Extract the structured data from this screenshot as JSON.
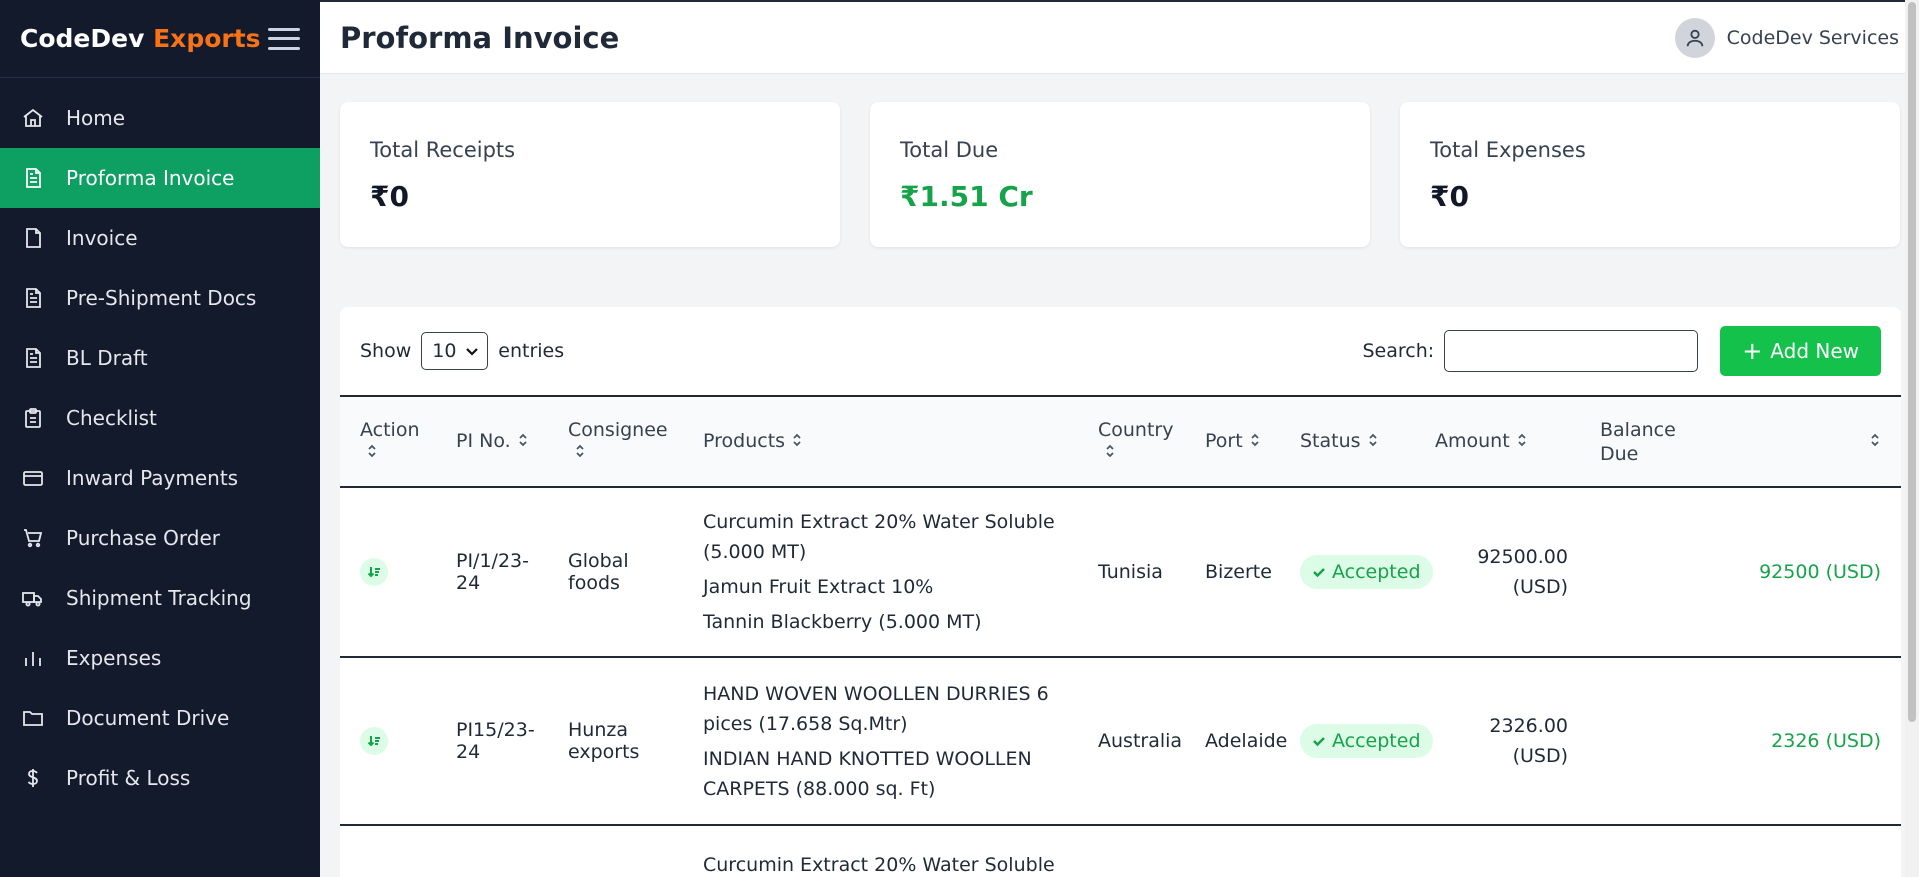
{
  "brand": {
    "name": "CodeDev",
    "accent": "Exports"
  },
  "nav": [
    {
      "label": "Home",
      "icon": "home-icon",
      "active": false
    },
    {
      "label": "Proforma Invoice",
      "icon": "document-icon",
      "active": true
    },
    {
      "label": "Invoice",
      "icon": "file-icon",
      "active": false
    },
    {
      "label": "Pre-Shipment Docs",
      "icon": "document-icon",
      "active": false
    },
    {
      "label": "BL Draft",
      "icon": "document-icon",
      "active": false
    },
    {
      "label": "Checklist",
      "icon": "clipboard-icon",
      "active": false
    },
    {
      "label": "Inward Payments",
      "icon": "credit-card-icon",
      "active": false
    },
    {
      "label": "Purchase Order",
      "icon": "cart-icon",
      "active": false
    },
    {
      "label": "Shipment Tracking",
      "icon": "truck-icon",
      "active": false
    },
    {
      "label": "Expenses",
      "icon": "bar-chart-icon",
      "active": false
    },
    {
      "label": "Document Drive",
      "icon": "folder-icon",
      "active": false
    },
    {
      "label": "Profit & Loss",
      "icon": "dollar-icon",
      "active": false
    }
  ],
  "header": {
    "title": "Proforma Invoice",
    "user": "CodeDev Services"
  },
  "stats": [
    {
      "label": "Total Receipts",
      "value": "₹0",
      "highlight": false
    },
    {
      "label": "Total Due",
      "value": "₹1.51 Cr",
      "highlight": true
    },
    {
      "label": "Total Expenses",
      "value": "₹0",
      "highlight": false
    }
  ],
  "toolbar": {
    "show_label": "Show",
    "page_size": "10",
    "entries_label": "entries",
    "search_label": "Search:",
    "search_value": "",
    "add_label": "Add New"
  },
  "columns": [
    "Action",
    "PI No.",
    "Consignee",
    "Products",
    "Country",
    "Port",
    "Status",
    "Amount",
    "Balance Due"
  ],
  "rows": [
    {
      "pi_no": "PI/1/23-24",
      "consignee": "Global foods",
      "products": [
        "Curcumin Extract 20% Water Soluble (5.000 MT)",
        "Jamun Fruit Extract 10%",
        "Tannin Blackberry (5.000 MT)"
      ],
      "country": "Tunisia",
      "port": "Bizerte",
      "status": "Accepted",
      "amount": "92500.00 (USD)",
      "balance": "92500 (USD)"
    },
    {
      "pi_no": "PI15/23-24",
      "consignee": "Hunza exports",
      "products": [
        "HAND WOVEN WOOLLEN DURRIES 6 pices (17.658 Sq.Mtr)",
        "INDIAN HAND KNOTTED WOOLLEN CARPETS (88.000 sq. Ft)"
      ],
      "country": "Australia",
      "port": "Adelaide",
      "status": "Accepted",
      "amount": "2326.00 (USD)",
      "balance": "2326 (USD)"
    },
    {
      "pi_no": "",
      "consignee": "",
      "products": [
        "Curcumin Extract 20% Water Soluble"
      ],
      "country": "",
      "port": "",
      "status": "",
      "amount": "",
      "balance": ""
    }
  ],
  "colors": {
    "sidebar": "#121a2c",
    "active": "#0e9f63",
    "accent": "#f97316",
    "success": "#16a34a"
  }
}
